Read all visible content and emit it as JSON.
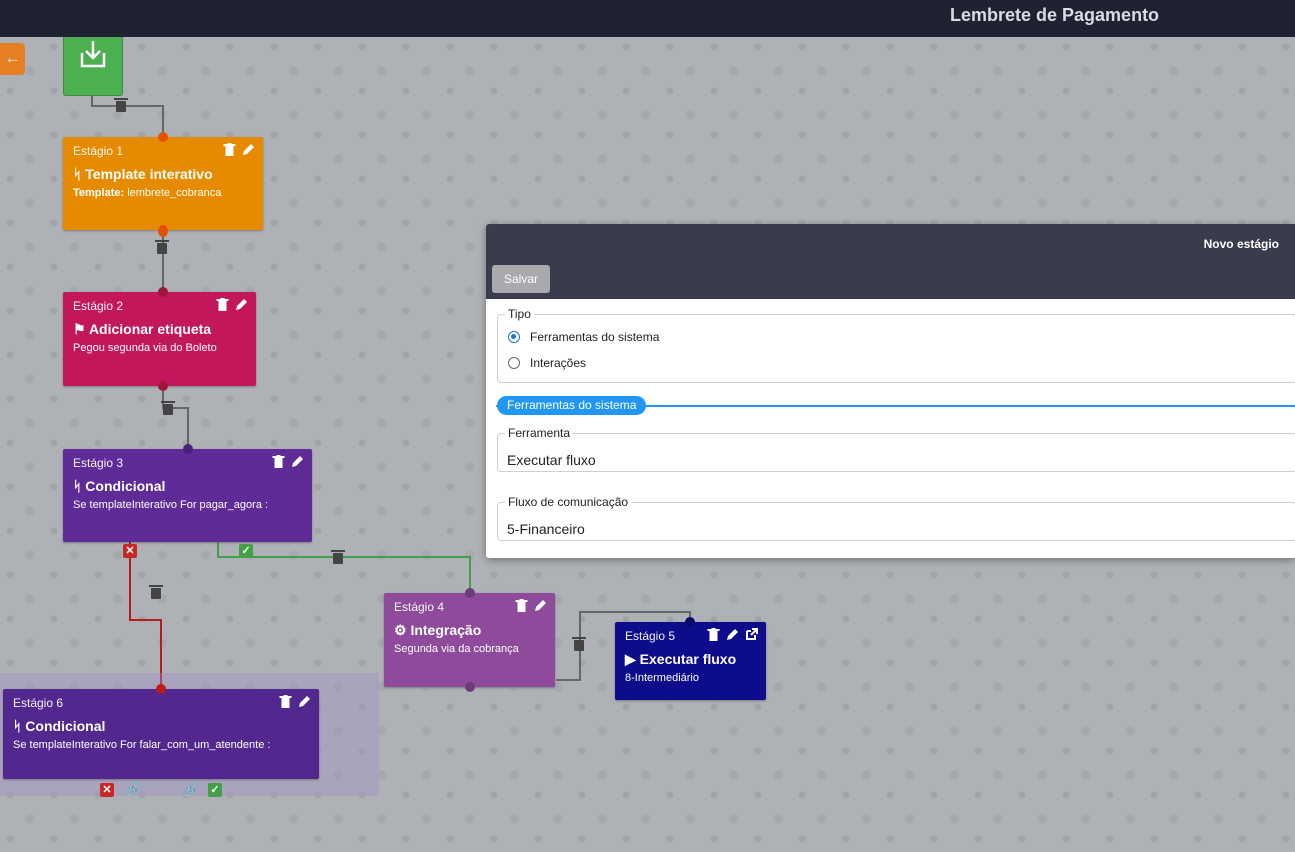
{
  "app": {
    "title": "Lembrete de Pagamento"
  },
  "icons": {
    "back": "arrow-left-icon",
    "start": "download-icon",
    "delete": "trash-icon",
    "edit": "pencil-icon",
    "open": "external-link-icon"
  },
  "nodes": [
    {
      "stage": "Estágio 1",
      "icon": "branch-icon",
      "name": "Template interativo",
      "desc_label": "Template:",
      "desc": " lembrete_cobranca",
      "color": "#e68a00"
    },
    {
      "stage": "Estágio 2",
      "icon": "tag-icon",
      "name": "Adicionar etiqueta",
      "desc_label": "",
      "desc": "Pegou segunda via do Boleto",
      "color": "#c2185b"
    },
    {
      "stage": "Estágio 3",
      "icon": "branch-icon",
      "name": "Condicional",
      "desc_label": "",
      "desc": "Se templateInterativo For pagar_agora :",
      "color": "#5e2b97"
    },
    {
      "stage": "Estágio 4",
      "icon": "gear-icon",
      "name": "Integração",
      "desc_label": "",
      "desc": "Segunda via da cobrança",
      "color": "#8e4b9b"
    },
    {
      "stage": "Estágio 5",
      "icon": "play-icon",
      "name": "Executar fluxo",
      "desc_label": "",
      "desc": "8-Intermediário",
      "color": "#0d0d8c"
    },
    {
      "stage": "Estágio 6",
      "icon": "branch-icon",
      "name": "Condicional",
      "desc_label": "",
      "desc": "Se templateInterativo For falar_com_um_atendente :",
      "color": "#52288f"
    }
  ],
  "modal": {
    "title": "Novo estágio",
    "save_label": "Salvar",
    "tipo": {
      "legend": "Tipo",
      "options": [
        "Ferramentas do sistema",
        "Interações"
      ],
      "selected": "Ferramentas do sistema"
    },
    "section": "Ferramentas do sistema",
    "ferramenta": {
      "legend": "Ferramenta",
      "value": "Executar fluxo"
    },
    "fluxo": {
      "legend": "Fluxo de comunicação",
      "value": "5-Financeiro"
    }
  },
  "colors": {
    "topbar": "#1f2231",
    "modal_head": "#3a3b4d",
    "accent": "#2196f3",
    "success": "#43a047",
    "danger": "#c62828",
    "start": "#4caf50"
  }
}
